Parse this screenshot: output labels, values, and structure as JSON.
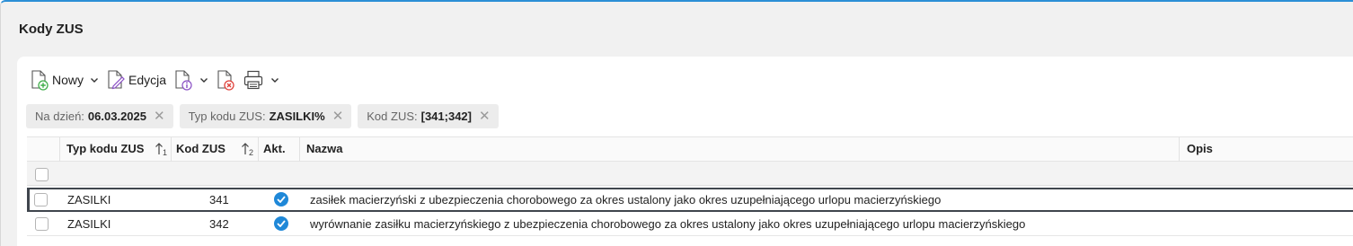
{
  "window": {
    "title": "Kody ZUS"
  },
  "toolbar": {
    "new_label": "Nowy",
    "edit_label": "Edycja"
  },
  "filters": [
    {
      "label": "Na dzień:",
      "value": "06.03.2025"
    },
    {
      "label": "Typ kodu ZUS:",
      "value": "ZASILKI%"
    },
    {
      "label": "Kod ZUS:",
      "value": "[341;342]"
    }
  ],
  "grid": {
    "columns": {
      "type": "Typ kodu ZUS",
      "type_sort": "1",
      "code": "Kod ZUS",
      "code_sort": "2",
      "active": "Akt.",
      "name": "Nazwa",
      "desc": "Opis"
    },
    "rows": [
      {
        "type": "ZASILKI",
        "code": "341",
        "active": true,
        "name": "zasiłek macierzyński z ubezpieczenia chorobowego za okres ustalony jako okres uzupełniającego urlopu macierzyńskiego",
        "desc": ""
      },
      {
        "type": "ZASILKI",
        "code": "342",
        "active": true,
        "name": "wyrównanie zasiłku macierzyńskiego z ubezpieczenia chorobowego za okres ustalony jako okres uzupełniającego urlopu macierzyńskiego",
        "desc": ""
      }
    ]
  },
  "colors": {
    "accent": "#2b8fd6",
    "check": "#1f88d8",
    "icon_green": "#3fae49",
    "icon_red": "#e0413a",
    "icon_purple": "#8a4fc4"
  }
}
